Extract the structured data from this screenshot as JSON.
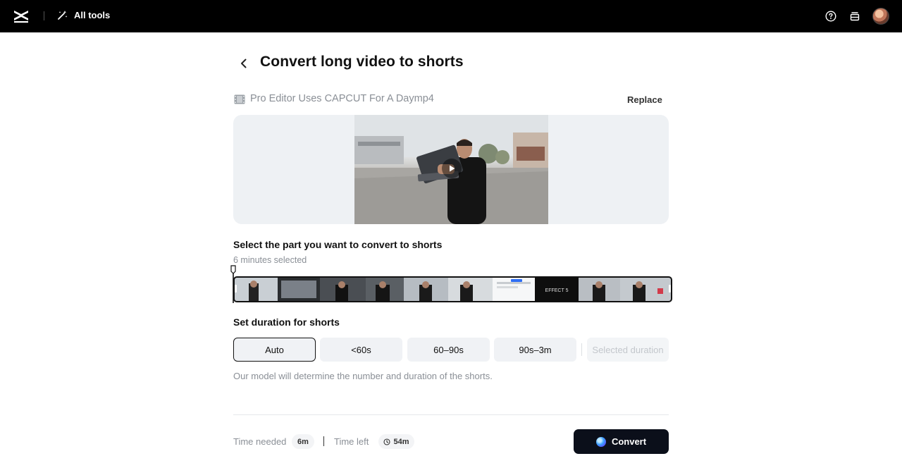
{
  "topbar": {
    "all_tools_label": "All tools"
  },
  "header": {
    "title": "Convert long video to shorts"
  },
  "file": {
    "name": "Pro Editor Uses CAPCUT For A Daymp4",
    "replace_label": "Replace"
  },
  "select": {
    "title": "Select the part you want to convert to shorts",
    "selected_text": "6 minutes selected",
    "frame_caption": "EFFECT 5"
  },
  "duration": {
    "title": "Set duration for shorts",
    "options": [
      "Auto",
      "<60s",
      "60–90s",
      "90s–3m",
      "Selected duration"
    ],
    "active": "Auto",
    "hint": "Our model will determine the number and duration of the shorts."
  },
  "footer": {
    "time_needed_label": "Time needed",
    "time_needed_value": "6m",
    "time_left_label": "Time left",
    "time_left_value": "54m",
    "convert_label": "Convert"
  },
  "colors": {
    "topbar": "#000000",
    "convert_button": "#0b0f1a",
    "muted_text": "#8a8f96",
    "preview_bg": "#eef1f4"
  }
}
